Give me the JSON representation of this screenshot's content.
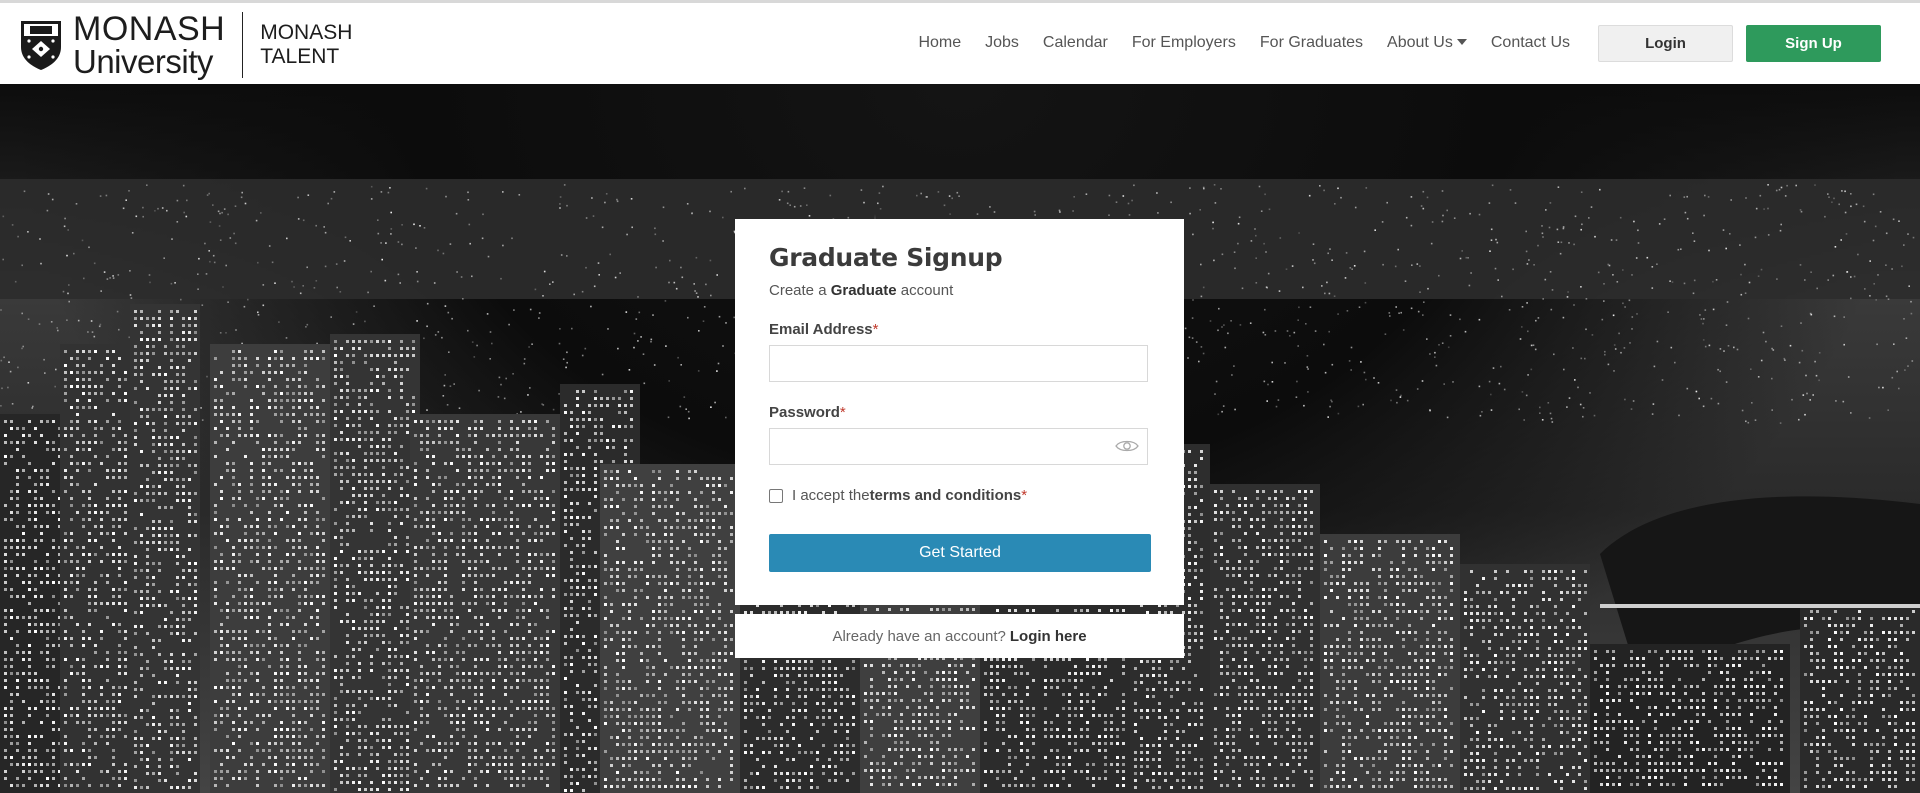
{
  "header": {
    "logo_line1": "MONASH",
    "logo_line2": "University",
    "talent_line1": "MONASH",
    "talent_line2": "TALENT"
  },
  "nav": {
    "items": [
      {
        "label": "Home"
      },
      {
        "label": "Jobs"
      },
      {
        "label": "Calendar"
      },
      {
        "label": "For Employers"
      },
      {
        "label": "For Graduates"
      },
      {
        "label": "About Us",
        "has_dropdown": true
      },
      {
        "label": "Contact Us"
      }
    ],
    "login_label": "Login",
    "signup_label": "Sign Up"
  },
  "form": {
    "title": "Graduate Signup",
    "subtitle_prefix": "Create a ",
    "subtitle_bold": "Graduate",
    "subtitle_suffix": " account",
    "email_label": "Email Address",
    "email_value": "",
    "password_label": "Password",
    "password_value": "",
    "required_mark": "*",
    "terms_prefix": "I accept the ",
    "terms_link": "terms and conditions",
    "terms_checked": false,
    "submit_label": "Get Started",
    "footer_text": "Already have an account?",
    "footer_link": "Login here"
  },
  "colors": {
    "signup_green": "#2e9a5c",
    "submit_blue": "#2a8ab5",
    "required_red": "#c0392b"
  },
  "icons": {
    "password_toggle": "eye-icon",
    "logo_crest": "monash-crest-icon",
    "dropdown": "chevron-down-icon"
  }
}
